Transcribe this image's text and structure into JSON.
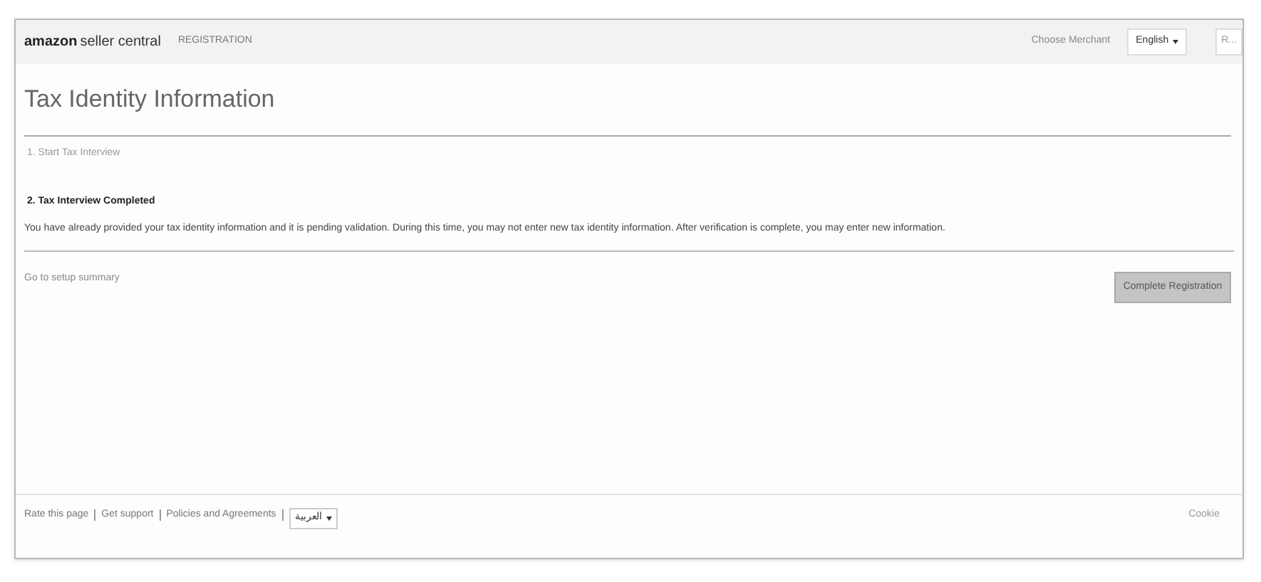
{
  "header": {
    "logo": {
      "brand": "amazon",
      "product": "seller central"
    },
    "section": "REGISTRATION",
    "merchant_link": "Choose Merchant",
    "language": "English",
    "cut_button": "R..."
  },
  "title": "Tax Identity Information",
  "steps": [
    {
      "label": "1. Start Tax Interview",
      "completed": false
    },
    {
      "label": "2. Tax Interview Completed",
      "completed": true,
      "message": "You have already provided your tax identity information and it is pending validation. During this time, you may not enter new tax identity information. After verification is complete, you may enter new information."
    }
  ],
  "summary_link": "Go to setup summary",
  "primary_button": "Complete Registration",
  "footer": {
    "links": [
      "Rate this page",
      "Get support",
      "Policies and Agreements"
    ],
    "language": "العربية",
    "right_link": "Cookie"
  }
}
